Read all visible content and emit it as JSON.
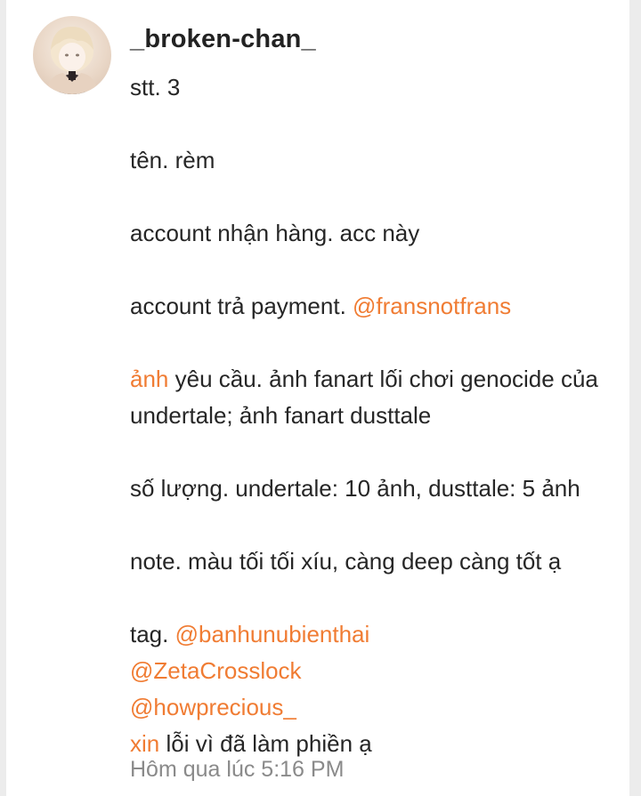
{
  "comment": {
    "username": "_broken-chan_",
    "stt": "stt. 3",
    "ten": "tên. rèm",
    "account_nhan": "account nhận hàng. acc này",
    "account_tra_label": "account trả payment. ",
    "account_tra_mention": "@fransnotfrans",
    "anh_link": "ảnh",
    "anh_rest": " yêu cầu. ảnh fanart lối chơi genocide của",
    "anh_rest2": "undertale; ảnh fanart dusttale",
    "so_luong": "số lượng. undertale: 10 ảnh, dusttale: 5 ảnh",
    "note": "note. màu tối tối xíu, càng deep càng tốt ạ",
    "tag_label": "tag. ",
    "mentions": [
      "@banhunubienthai",
      "@ZetaCrosslock",
      "@howprecious_"
    ],
    "xin_link": "xin",
    "xin_rest": " lỗi vì đã làm phiền ạ",
    "timestamp": "Hôm qua lúc 5:16 PM"
  },
  "colors": {
    "link": "#f07c33",
    "text": "#262626",
    "timestamp": "#8a8a8a",
    "background": "#ececec",
    "card": "#ffffff"
  },
  "icons": {
    "avatar": "anime-avatar-image"
  }
}
